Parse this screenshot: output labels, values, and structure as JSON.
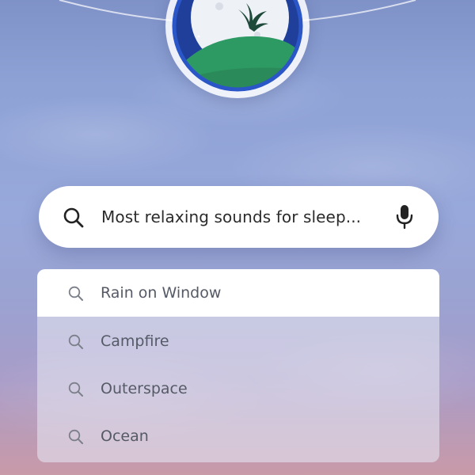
{
  "search": {
    "query": "Most relaxing sounds for sleep...",
    "icon": "search-icon",
    "mic_icon": "microphone-icon"
  },
  "suggestions": [
    {
      "label": "Rain on Window",
      "icon": "search-icon"
    },
    {
      "label": "Campfire",
      "icon": "search-icon"
    },
    {
      "label": "Outerspace",
      "icon": "search-icon"
    },
    {
      "label": "Ocean",
      "icon": "search-icon"
    }
  ],
  "colors": {
    "sky_top": "#7f92c8",
    "sky_bottom": "#c99aa8",
    "logo_night": "#1f3f9a",
    "moon": "#eef1f6",
    "hill": "#2e9a63",
    "plant": "#1e4a3a"
  }
}
